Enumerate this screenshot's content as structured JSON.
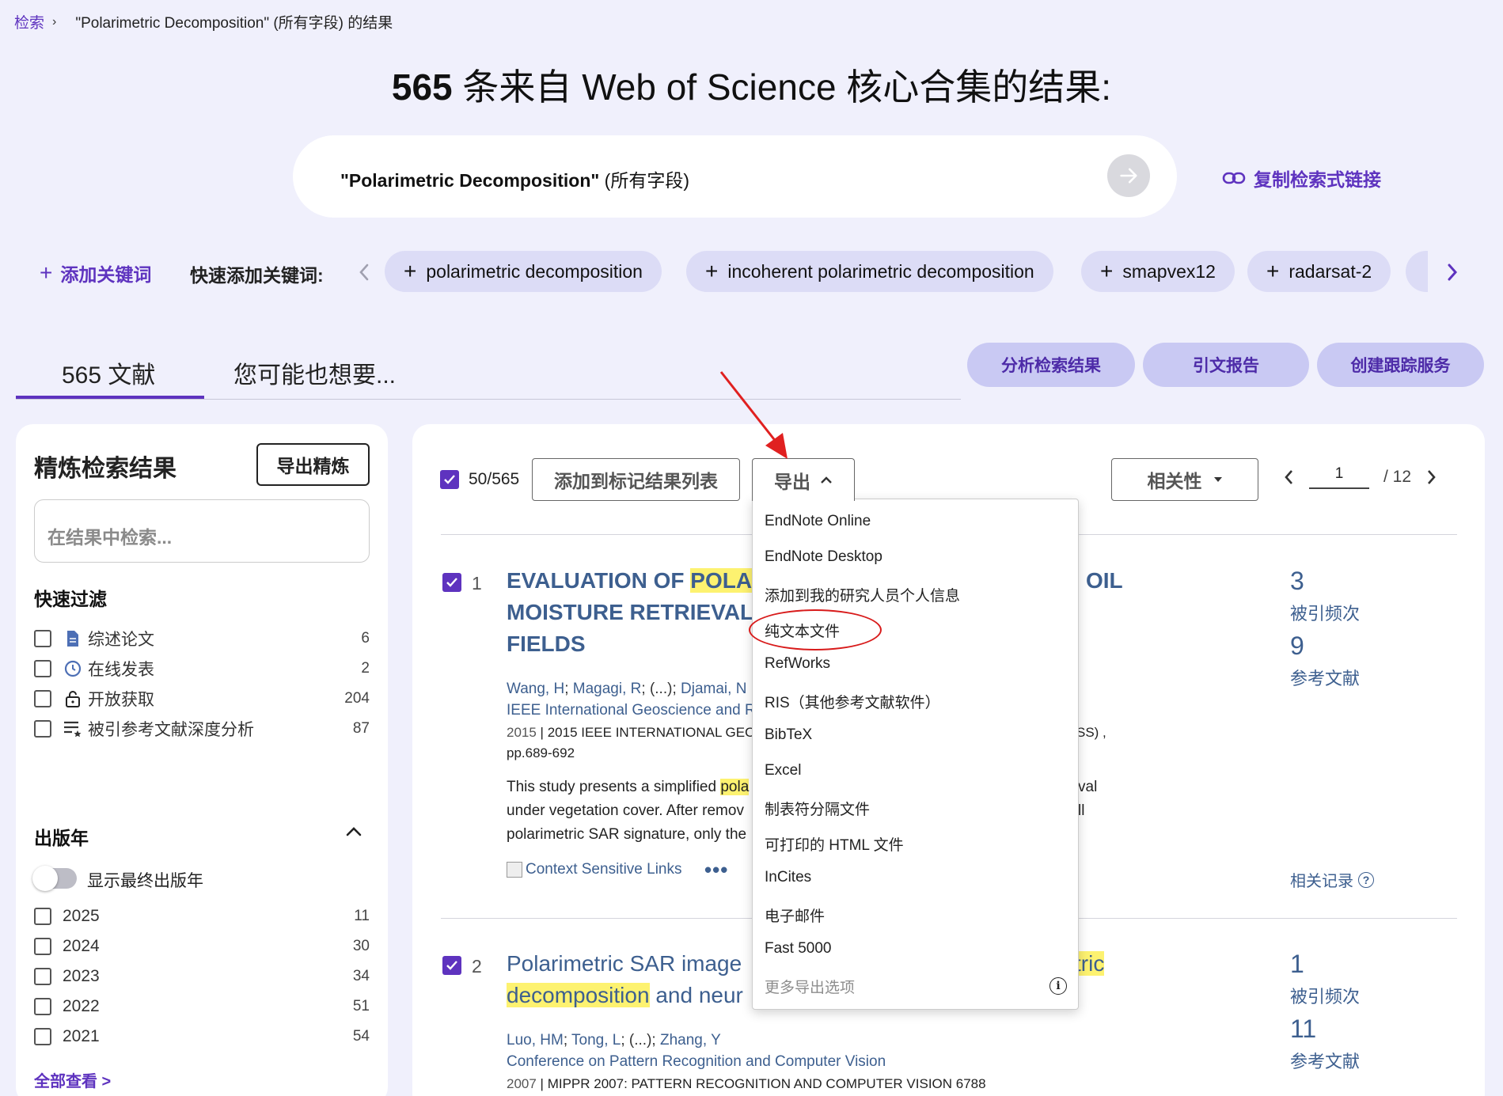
{
  "breadcrumb": {
    "link": "检索",
    "separator": "›",
    "current": "\"Polarimetric Decomposition\" (所有字段) 的结果"
  },
  "page_title": {
    "count": "565",
    "text": " 条来自 Web of Science 核心合集的结果:"
  },
  "search": {
    "query_bold": "\"Polarimetric Decomposition\"",
    "query_rest": " (所有字段)",
    "copy_link_label": "复制检索式链接"
  },
  "keywords": {
    "add_label": "添加关键词",
    "quick_label": "快速添加关键词:",
    "chips": [
      "polarimetric decomposition",
      "incoherent polarimetric decomposition",
      "smapvex12",
      "radarsat-2"
    ]
  },
  "tabs": {
    "documents": "565 文献",
    "suggested": "您可能也想要..."
  },
  "actions": {
    "analyze": "分析检索结果",
    "citation_report": "引文报告",
    "create_alert": "创建跟踪服务"
  },
  "refine": {
    "title": "精炼检索结果",
    "export_label": "导出精炼",
    "search_placeholder": "在结果中检索...",
    "quick_filter_title": "快速过滤",
    "quick_filters": [
      {
        "label": "综述论文",
        "count": "6",
        "icon": "document-icon"
      },
      {
        "label": "在线发表",
        "count": "2",
        "icon": "clock-icon"
      },
      {
        "label": "开放获取",
        "count": "204",
        "icon": "lock-open-icon"
      },
      {
        "label": "被引参考文献深度分析",
        "count": "87",
        "icon": "list-star-icon"
      }
    ],
    "pub_year_title": "出版年",
    "final_year_toggle": "显示最终出版年",
    "years": [
      {
        "label": "2025",
        "count": "11"
      },
      {
        "label": "2024",
        "count": "30"
      },
      {
        "label": "2023",
        "count": "34"
      },
      {
        "label": "2022",
        "count": "51"
      },
      {
        "label": "2021",
        "count": "54"
      }
    ],
    "see_all": "全部查看 >"
  },
  "toolbar": {
    "selected": "50/565",
    "add_marked": "添加到标记结果列表",
    "export": "导出",
    "sort": "相关性",
    "page_current": "1",
    "page_total": "/ 12"
  },
  "export_menu": {
    "items": [
      "EndNote Online",
      "EndNote Desktop",
      "添加到我的研究人员个人信息",
      "纯文本文件",
      "RefWorks",
      "RIS（其他参考文献软件）",
      "BibTeX",
      "Excel",
      "制表符分隔文件",
      "可打印的 HTML 文件",
      "InCites",
      "电子邮件",
      "Fast 5000"
    ],
    "more_options": "更多导出选项"
  },
  "records": [
    {
      "num": "1",
      "title_line1_pre": "EVALUATION OF ",
      "title_line1_hl": "POLARI",
      "title_line1_right": "OIL",
      "title_line2": "MOISTURE RETRIEVAL O",
      "title_line3": "FIELDS",
      "authors": [
        "Wang, H",
        "Magagi, R",
        "(...)",
        "Djamai, N"
      ],
      "source": "IEEE International Geoscience and R",
      "year": "2015",
      "pub_info": "2015 IEEE INTERNATIONAL GEO",
      "pub_info_right": "SS) ,",
      "pages": "pp.689-692",
      "abstract_1_pre": "This study presents a simplified ",
      "abstract_1_hl": "pola",
      "abstract_1_right": "val",
      "abstract_2": "under vegetation cover. After remov",
      "abstract_2_right": "ll",
      "abstract_3": "polarimetric SAR signature, only the",
      "links_alt": "Context Sensitive Links",
      "more": "•••",
      "citations": "3",
      "citations_label": "被引频次",
      "references": "9",
      "references_label": "参考文献",
      "related": "相关记录"
    },
    {
      "num": "2",
      "title_line1": "Polarimetric SAR image ",
      "title_line1_hl_right": "tric",
      "title_line2_hl": "decomposition",
      "title_line2_rest": " and neur",
      "authors": [
        "Luo, HM",
        "Tong, L",
        "(...)",
        "Zhang, Y"
      ],
      "source": "Conference on Pattern Recognition and Computer Vision",
      "year": "2007",
      "pub_info": "MIPPR 2007: PATTERN RECOGNITION AND COMPUTER VISION 6788",
      "citations": "1",
      "citations_label": "被引频次",
      "references": "11",
      "references_label": "参考文献"
    }
  ],
  "colors": {
    "accent": "#5e33bf",
    "link_blue": "#3d5f8f",
    "highlight": "#fdf270",
    "annotation_red": "#d81b1b"
  }
}
